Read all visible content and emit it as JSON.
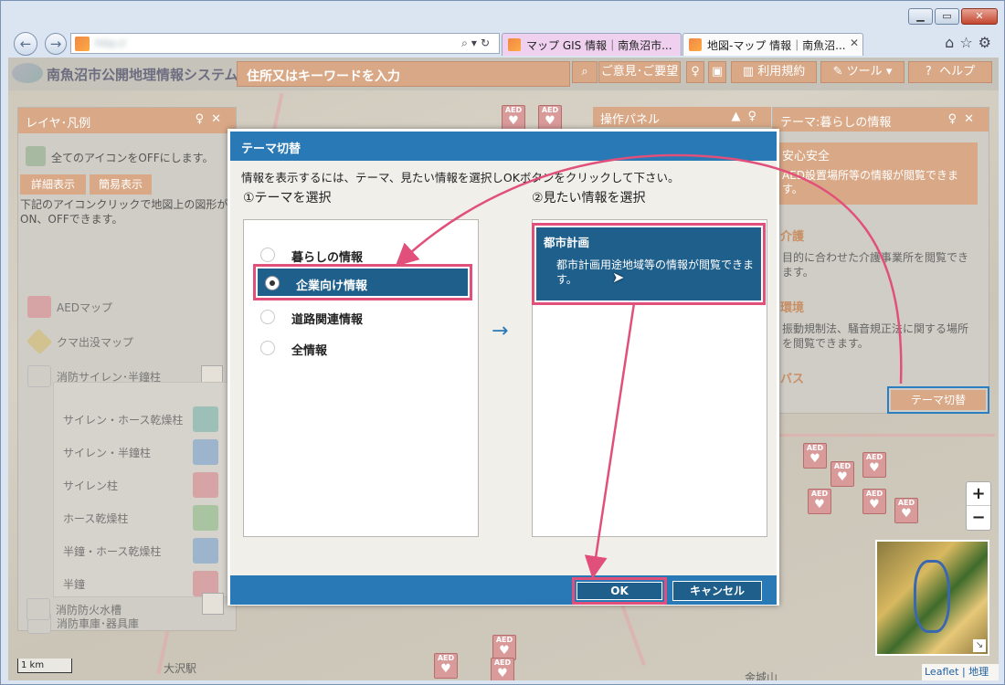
{
  "browser": {
    "address": "http://",
    "tabs": [
      {
        "title": "マップ GIS 情報｜南魚沼市..."
      },
      {
        "title": "地図-マップ 情報｜南魚沼...",
        "close": "✕"
      }
    ]
  },
  "header": {
    "site_title": "南魚沼市公開地理情報システム",
    "search_placeholder": "住所又はキーワードを入力",
    "opinion": "ご意見･ご要望",
    "terms": "利用規約",
    "tools": "ツール",
    "help": "ヘルプ"
  },
  "layer_panel": {
    "title": "レイヤ･凡例",
    "all_off": "全てのアイコンをOFFにします。",
    "detail_btn": "詳細表示",
    "simple_btn": "簡易表示",
    "desc": "下記のアイコンクリックで地図上の図形が ON、OFFできます。",
    "items": [
      {
        "label": "AEDマップ"
      },
      {
        "label": "クマ出没マップ"
      },
      {
        "label": "消防サイレン･半鐘柱"
      }
    ],
    "sub_items": [
      {
        "label": "サイレン・ホース乾燥柱"
      },
      {
        "label": "サイレン・半鐘柱"
      },
      {
        "label": "サイレン柱"
      },
      {
        "label": "ホース乾燥柱"
      },
      {
        "label": "半鐘・ホース乾燥柱"
      },
      {
        "label": "半鐘"
      }
    ],
    "bottom_items": [
      {
        "label": "消防車庫･器具庫"
      },
      {
        "label": "消防防火水槽"
      }
    ]
  },
  "op_panel": {
    "title": "操作パネル"
  },
  "theme_panel": {
    "title": "テーマ:暮らしの情報",
    "cards": [
      {
        "title": "安心安全",
        "desc": "AED設置場所等の情報が閲覧できます。"
      },
      {
        "title": "介護",
        "desc": "目的に合わせた介護事業所を閲覧できます。"
      },
      {
        "title": "環境",
        "desc": "振動規制法、騒音規正法に関する場所を閲覧できます。"
      },
      {
        "title": "バス",
        "desc": ""
      }
    ],
    "switch_btn": "テーマ切替"
  },
  "map": {
    "scale": "1 km",
    "attribution": "Leaflet | 地理院",
    "place1": "大沢駅",
    "place2": "金城山"
  },
  "dialog": {
    "title": "テーマ切替",
    "instruction": "情報を表示するには、テーマ、見たい情報を選択しOKボタンをクリックして下さい。",
    "step1": "①テーマを選択",
    "step2": "②見たい情報を選択",
    "themes": [
      {
        "label": "暮らしの情報",
        "selected": false
      },
      {
        "label": "企業向け情報",
        "selected": true
      },
      {
        "label": "道路関連情報",
        "selected": false
      },
      {
        "label": "全情報",
        "selected": false
      }
    ],
    "info": {
      "title": "都市計画",
      "desc": "都市計画用途地域等の情報が閲覧できます。"
    },
    "ok": "OK",
    "cancel": "キャンセル"
  },
  "colors": {
    "accent_blue": "#2879b6",
    "selected_dark": "#1f5f8b",
    "highlight_pink": "#e0507a",
    "panel_orange": "#d9a987"
  }
}
